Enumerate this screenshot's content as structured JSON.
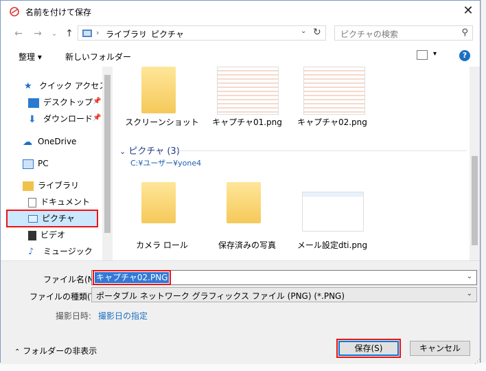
{
  "window": {
    "title": "名前を付けて保存",
    "close_label": "✕"
  },
  "nav": {
    "back_icon": "←",
    "forward_icon": "→",
    "recent_icon": "⌄",
    "up_icon": "↑",
    "breadcrumbs": [
      "ライブラリ",
      "ピクチャ"
    ],
    "refresh_icon": "↻",
    "search_placeholder": "ピクチャの検索"
  },
  "toolbar": {
    "organize": "整理 ▾",
    "new_folder": "新しいフォルダー",
    "help": "?"
  },
  "sidebar": {
    "items": [
      {
        "label": "クイック アクセス",
        "icon": "star-icon"
      },
      {
        "label": "デスクトップ",
        "icon": "desktop-icon",
        "pinned": true
      },
      {
        "label": "ダウンロード",
        "icon": "download-icon",
        "pinned": true
      },
      {
        "label": "OneDrive",
        "icon": "cloud-icon"
      },
      {
        "label": "PC",
        "icon": "computer-icon"
      },
      {
        "label": "ライブラリ",
        "icon": "library-icon"
      },
      {
        "label": "ドキュメント",
        "icon": "document-icon"
      },
      {
        "label": "ピクチャ",
        "icon": "picture-icon",
        "selected": true
      },
      {
        "label": "ビデオ",
        "icon": "video-icon"
      },
      {
        "label": "ミュージック",
        "icon": "music-icon"
      }
    ]
  },
  "content": {
    "top_items": [
      {
        "label": "スクリーンショット",
        "kind": "folder"
      },
      {
        "label": "キャプチャ01.png",
        "kind": "image"
      },
      {
        "label": "キャプチャ02.png",
        "kind": "image"
      }
    ],
    "group": {
      "title": "ピクチャ (3)",
      "path": "C:¥ユーザー¥yone4"
    },
    "group_items": [
      {
        "label": "カメラ ロール",
        "kind": "folder"
      },
      {
        "label": "保存済みの写真",
        "kind": "folder"
      },
      {
        "label": "メール設定dti.png",
        "kind": "image"
      }
    ]
  },
  "form": {
    "filename_label": "ファイル名(N):",
    "filename_value": "キャプチャ02.PNG",
    "filetype_label": "ファイルの種類(T):",
    "filetype_value": "ポータブル ネットワーク グラフィックス ファイル (PNG) (*.PNG)",
    "date_label": "撮影日時:",
    "date_link": "撮影日の指定",
    "hide_folders": "フォルダーの非表示",
    "save_button": "保存(S)",
    "cancel_button": "キャンセル"
  },
  "colors": {
    "accent": "#0078d7",
    "highlight": "#e11111",
    "selection": "#3378d6"
  }
}
